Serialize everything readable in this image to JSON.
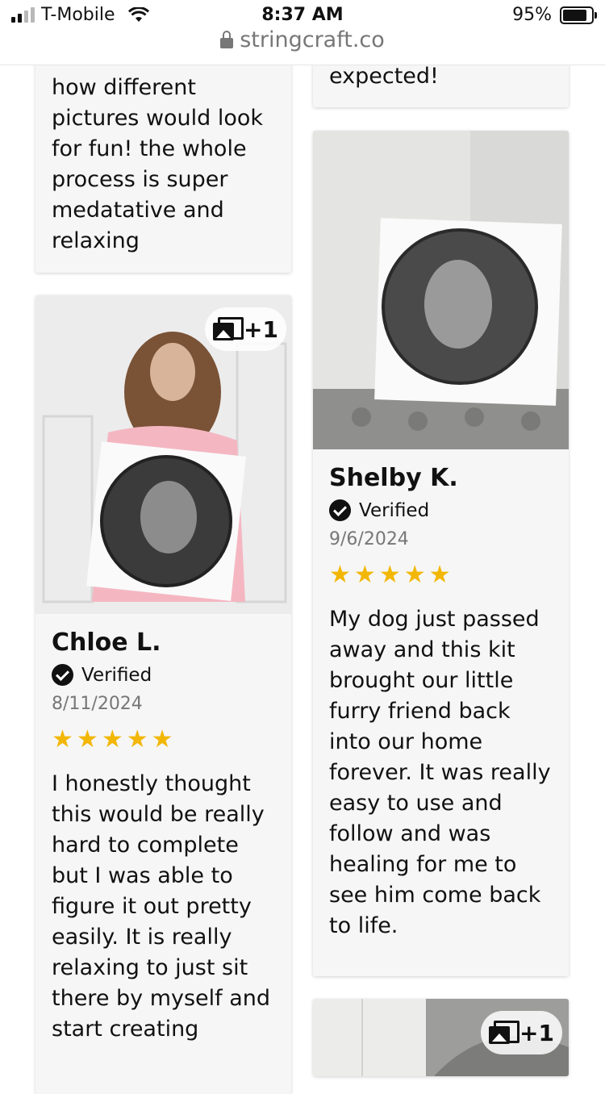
{
  "status_bar": {
    "carrier": "T-Mobile",
    "time": "8:37 AM",
    "battery": "95%",
    "battery_level": 0.95
  },
  "browser": {
    "url": "stringcraft.co"
  },
  "reviews": [
    {
      "text": "how different pictures would look for fun! the whole process is super medatative and relaxing"
    },
    {
      "text": "expected!"
    },
    {
      "photo_badge": "+1",
      "photo_alt": "Woman in pink blazer holding string art portrait",
      "name": "Chloe L.",
      "verified": "Verified",
      "date": "8/11/2024",
      "rating": 5,
      "text": "I honestly thought this would be really hard to complete but I was able to figure it out pretty easily. It is really relaxing to just sit there by myself and start creating"
    },
    {
      "photo_alt": "String art portrait on white board on tufted couch",
      "name": "Shelby K.",
      "verified": "Verified",
      "date": "9/6/2024",
      "rating": 5,
      "text": "My dog just passed away and this kit brought our little furry friend back into our home forever. It was really easy to use and follow and was healing for me to see him come back to life."
    },
    {
      "photo_badge": "+1"
    }
  ],
  "colors": {
    "star": "#f2b705",
    "card_bg": "#f6f6f6"
  }
}
